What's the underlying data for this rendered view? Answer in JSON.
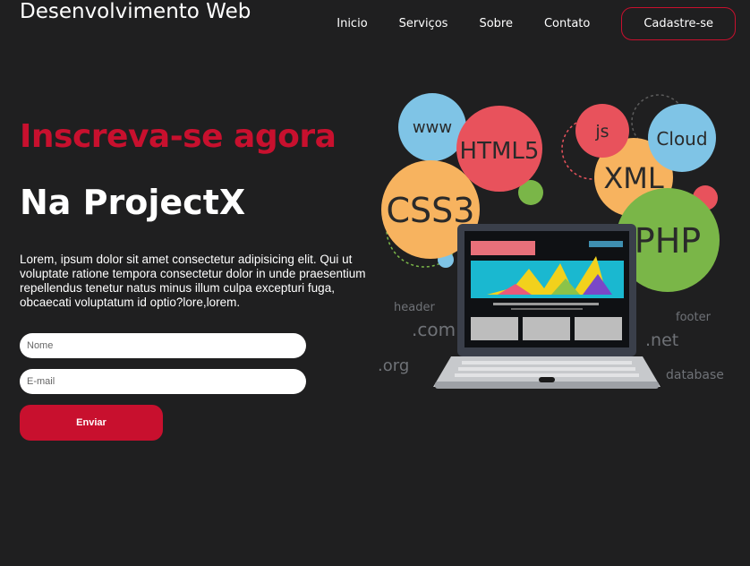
{
  "header": {
    "logo": "Desenvolvimento Web",
    "nav": [
      "Inicio",
      "Serviços",
      "Sobre",
      "Contato"
    ],
    "cta": "Cadastre-se"
  },
  "hero": {
    "title": "Inscreva-se agora",
    "subtitle": "Na ProjectX",
    "text": "Lorem, ipsum dolor sit amet consectetur adipisicing elit. Qui ut voluptate ratione tempora consectetur dolor in unde praesentium repellendus tenetur natus minus illum culpa excepturi fuga, obcaecati voluptatum id optio?lore,lorem."
  },
  "form": {
    "name_placeholder": "Nome",
    "email_placeholder": "E-mail",
    "submit_label": "Enviar"
  },
  "illustration": {
    "bubbles": [
      "www",
      "HTML5",
      "js",
      "Cloud",
      "XML",
      "CSS3",
      "PHP"
    ],
    "labels": [
      "header",
      ".com",
      ".org",
      "footer",
      ".net",
      "database"
    ]
  },
  "colors": {
    "background": "#1f1f20",
    "accent": "#c8102e"
  }
}
